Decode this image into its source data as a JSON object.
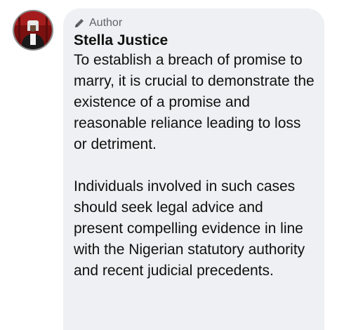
{
  "author": {
    "badge_icon": "pencil-icon",
    "badge_label": "Author",
    "name": "Stella Justice",
    "avatar_icon": "profile-photo"
  },
  "comment": {
    "paragraphs": [
      "To establish a breach of promise to marry, it is crucial to demonstrate the existence of a promise and reasonable reliance leading to loss or detriment.",
      "Individuals involved in such cases should seek legal advice and present compelling evidence in line with the Nigerian statutory authority and recent judicial precedents."
    ]
  },
  "colors": {
    "bubble_background": "#eef0f3",
    "badge_text": "#5f6368",
    "body_text": "#101010"
  }
}
